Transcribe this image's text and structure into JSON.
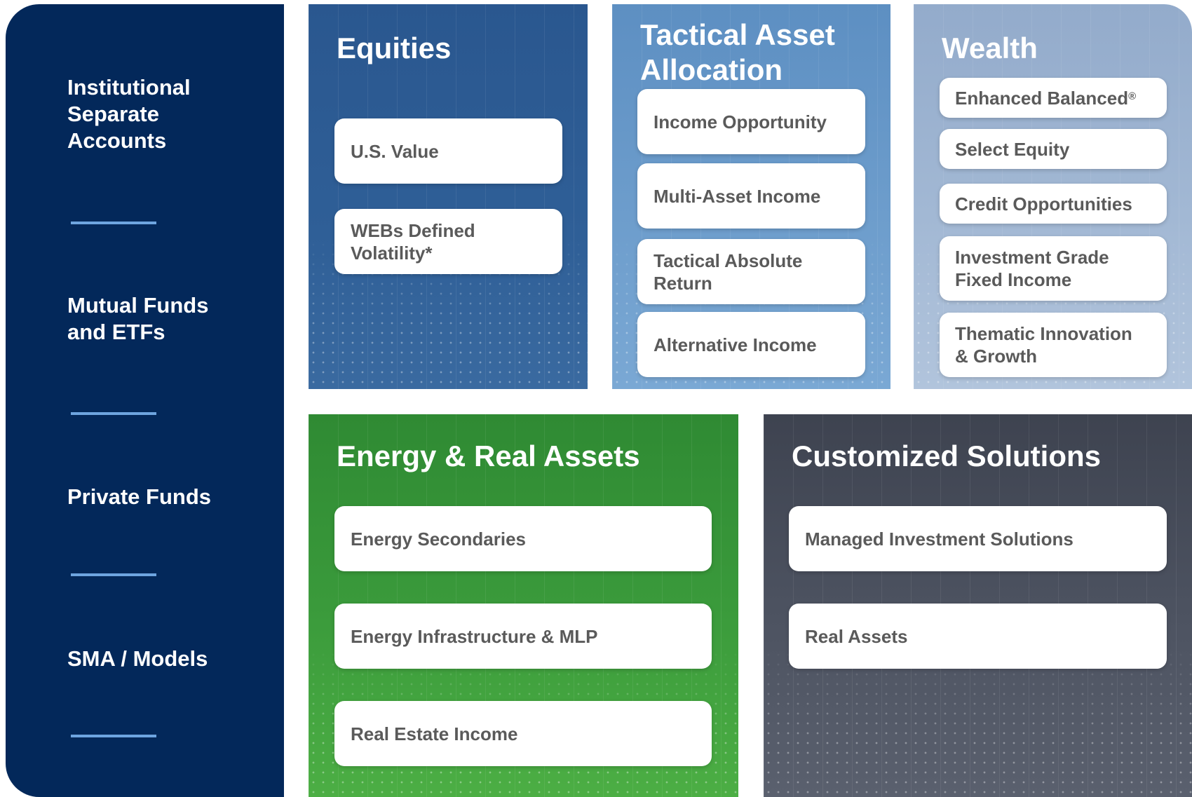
{
  "sidebar": {
    "items": [
      {
        "label": "Institutional\nSeparate\nAccounts"
      },
      {
        "label": "Mutual Funds\nand ETFs"
      },
      {
        "label": "Private Funds"
      },
      {
        "label": "SMA / Models"
      }
    ]
  },
  "panels": {
    "equities": {
      "title": "Equities",
      "color": "#2a578f",
      "items": [
        {
          "label": "U.S. Value"
        },
        {
          "label": "WEBs Defined\nVolatility*"
        }
      ]
    },
    "tactical": {
      "title": "Tactical Asset\nAllocation",
      "color": "#6b9bcb",
      "items": [
        {
          "label": "Income Opportunity"
        },
        {
          "label": "Multi-Asset Income"
        },
        {
          "label": "Tactical Absolute\nReturn"
        },
        {
          "label": "Alternative Income"
        }
      ]
    },
    "wealth": {
      "title": "Wealth",
      "color": "#9fb5d2",
      "items": [
        {
          "label": "Enhanced Balanced",
          "suffix": "®"
        },
        {
          "label": "Select Equity"
        },
        {
          "label": "Credit Opportunities"
        },
        {
          "label": "Investment Grade\nFixed Income"
        },
        {
          "label": "Thematic Innovation\n& Growth"
        }
      ]
    },
    "energy": {
      "title": "Energy & Real Assets",
      "color": "#3c9a3a",
      "items": [
        {
          "label": "Energy Secondaries"
        },
        {
          "label": "Energy Infrastructure & MLP"
        },
        {
          "label": "Real Estate Income"
        }
      ]
    },
    "custom": {
      "title": "Customized Solutions",
      "color": "#4c5260",
      "items": [
        {
          "label": "Managed Investment Solutions"
        },
        {
          "label": "Real Assets"
        }
      ]
    }
  }
}
